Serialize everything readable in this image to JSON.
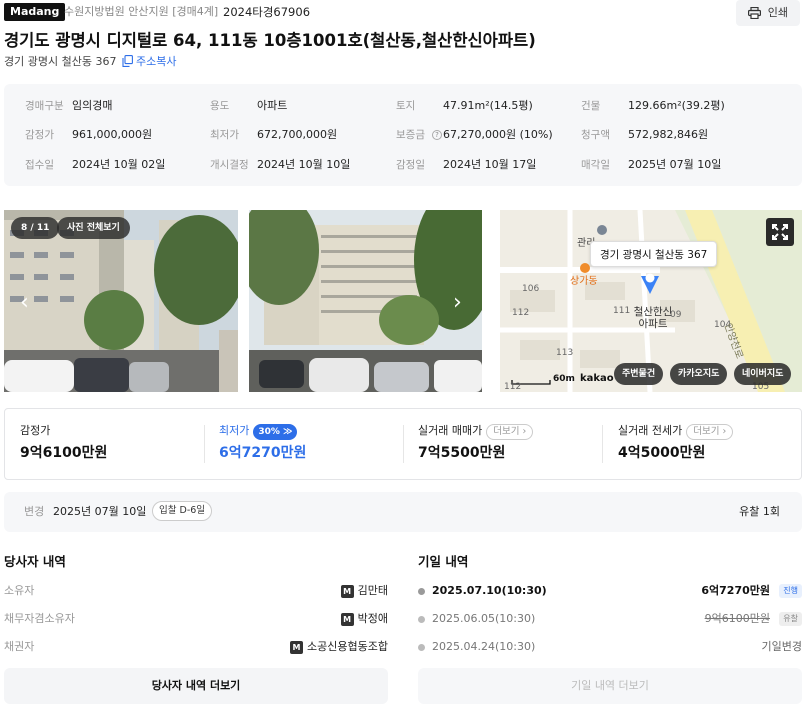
{
  "header": {
    "brand": "Madang",
    "court": "수원지방법원 안산지원 [경매4계]",
    "case_no": "2024타경67906",
    "print_label": "인쇄"
  },
  "address": {
    "title": "경기도 광명시 디지털로 64, 111동 10층1001호(철산동,철산한신아파트)",
    "lot": "경기 광명시 철산동 367",
    "copy_label": "주소복사"
  },
  "info": [
    [
      {
        "k": "경매구분",
        "v": "임의경매"
      },
      {
        "k": "용도",
        "v": "아파트"
      },
      {
        "k": "토지",
        "v": "47.91m²(14.5평)"
      },
      {
        "k": "건물",
        "v": "129.66m²(39.2평)"
      }
    ],
    [
      {
        "k": "감정가",
        "v": "961,000,000원"
      },
      {
        "k": "최저가",
        "v": "672,700,000원"
      },
      {
        "k": "보증금",
        "v": "67,270,000원 (10%)"
      },
      {
        "k": "청구액",
        "v": "572,982,846원"
      }
    ],
    [
      {
        "k": "접수일",
        "v": "2024년 10월 02일"
      },
      {
        "k": "개시결정",
        "v": "2024년 10월 10일"
      },
      {
        "k": "감정일",
        "v": "2024년 10월 17일"
      },
      {
        "k": "매각일",
        "v": "2025년 07월 10일"
      }
    ]
  ],
  "gallery": {
    "counter": "8 / 11",
    "view_all": "사진 전체보기"
  },
  "map": {
    "tooltip": "경기 광명시 철산동 367",
    "labels": {
      "apt": "철산한신\n아파트",
      "store": "상가동",
      "road": "안양천로",
      "gwan": "관리",
      "n106": "106",
      "n112": "112",
      "n113": "113",
      "n104": "104",
      "n111": "111",
      "n109": "09",
      "n105": "105",
      "n112b": "112"
    },
    "scale": "60m",
    "kakao": "kakao",
    "buttons": [
      "주변물건",
      "카카오지도",
      "네이버지도"
    ]
  },
  "prices": {
    "appraisal_label": "감정가",
    "appraisal_value": "9억6100만원",
    "min_label": "최저가",
    "min_pct": "30%",
    "min_value": "6억7270만원",
    "trade_label": "실거래 매매가",
    "trade_value": "7억5500만원",
    "jeonse_label": "실거래 전세가",
    "jeonse_value": "4억5000만원",
    "more_label": "더보기"
  },
  "change": {
    "label": "변경",
    "date": "2025년 07월 10일",
    "dday": "입찰 D-6일",
    "fail": "유찰 1회"
  },
  "parties": {
    "title": "당사자 내역",
    "rows": [
      {
        "k": "소유자",
        "v": "김만태"
      },
      {
        "k": "채무자겸소유자",
        "v": "박정애"
      },
      {
        "k": "채권자",
        "v": "소공신용협동조합"
      }
    ],
    "badge": "M",
    "more_button": "당사자 내역 더보기"
  },
  "dates": {
    "title": "기일 내역",
    "rows": [
      {
        "date": "2025.07.10(10:30)",
        "amount": "6억7270만원",
        "status": "진행"
      },
      {
        "date": "2025.06.05(10:30)",
        "amount": "9억6100만원",
        "status": "유찰"
      },
      {
        "date": "2025.04.24(10:30)",
        "amount": "",
        "status": "기일변경"
      }
    ],
    "more_button": "기일 내역 더보기"
  },
  "colors": {
    "accent": "#2d6ee8",
    "marker": "#3b82f6",
    "bg_soft": "#f6f7f9"
  }
}
